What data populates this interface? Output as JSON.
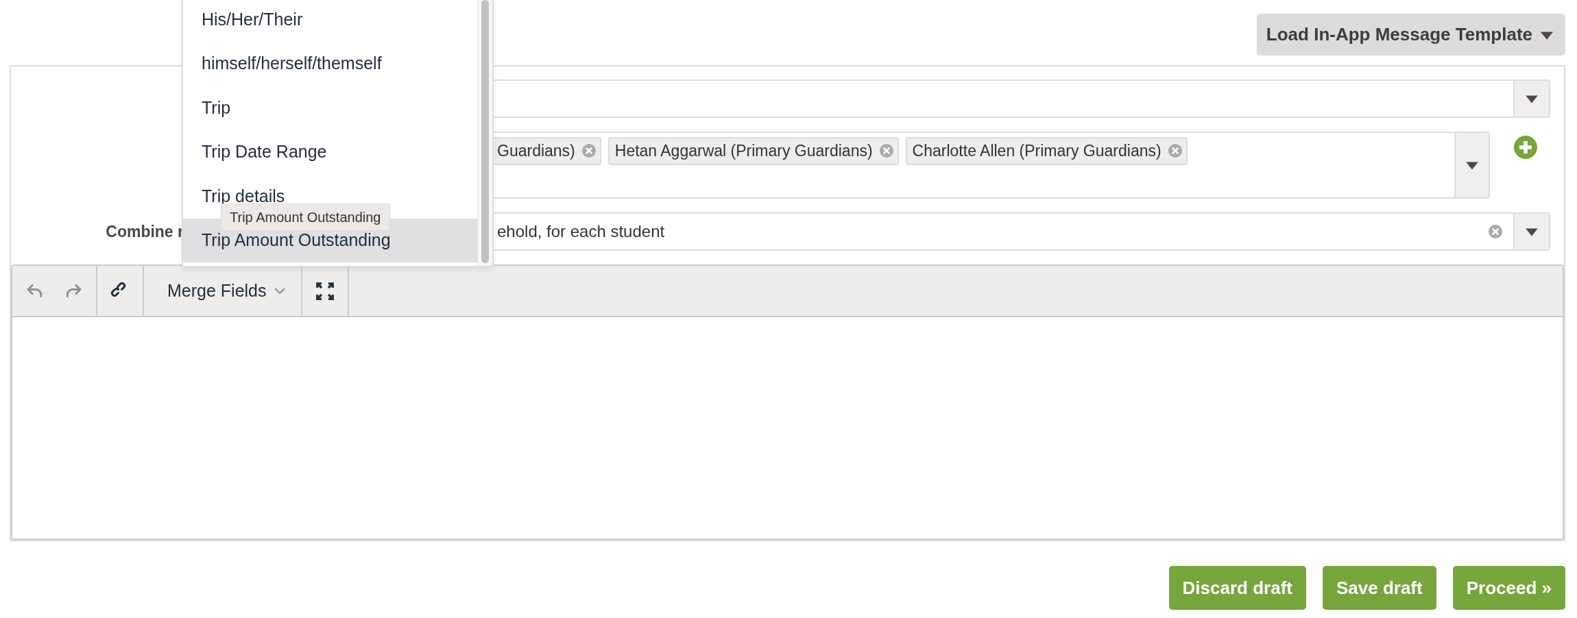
{
  "template_button": {
    "label": "Load In-App Message Template"
  },
  "fields": [
    {
      "kind": "select"
    },
    {
      "kind": "tags",
      "tags": [
        "Guardians)",
        "Hetan Aggarwal (Primary Guardians)",
        "Charlotte Allen (Primary Guardians)"
      ]
    },
    {
      "kind": "select",
      "label": "Combine r",
      "value": "ehold, for each student",
      "clearable": true
    }
  ],
  "editor": {
    "undo_disabled": true,
    "redo_disabled": true,
    "merge_fields_label": "Merge Fields"
  },
  "menu": {
    "items": [
      {
        "label": "His/Her/Their",
        "selected": false
      },
      {
        "label": "himself/herself/themself",
        "selected": false
      },
      {
        "label": "Trip",
        "selected": false
      },
      {
        "label": "Trip Date Range",
        "selected": false
      },
      {
        "label": "Trip details",
        "selected": false
      },
      {
        "label": "Trip Amount Outstanding",
        "selected": true
      }
    ],
    "tooltip": "Trip Amount Outstanding"
  },
  "actions": [
    "Discard draft",
    "Save draft",
    "Proceed »"
  ]
}
